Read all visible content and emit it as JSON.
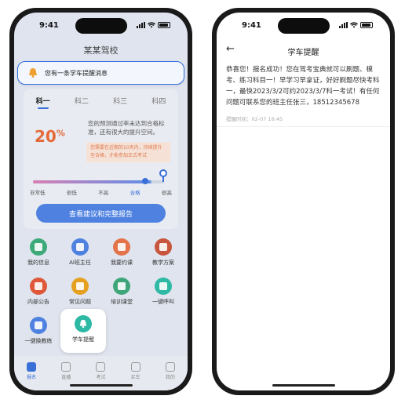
{
  "status": {
    "time": "9:41"
  },
  "left": {
    "title": "某某驾校",
    "toast": "您有一条学车提醒消息",
    "tabs": [
      "科一",
      "科二",
      "科三",
      "科四"
    ],
    "score": "20",
    "score_unit": "%",
    "score_desc": "您的预测通过率未达到合格标准，还有很大的提升空间。",
    "warn": "您需要在近期的10天内，持续提升至合格，才能参加正式考试",
    "progress": 0.82,
    "levels": [
      "非常低",
      "很低",
      "不高",
      "合格",
      "很高"
    ],
    "report_button": "查看建议和完整报告",
    "grid": [
      {
        "label": "我的信息",
        "color": "#3eaa7a",
        "icon": "id-card-icon"
      },
      {
        "label": "AI班主任",
        "color": "#4f82e0",
        "icon": "ai-person-icon"
      },
      {
        "label": "我要约课",
        "color": "#e4734a",
        "icon": "calendar-icon"
      },
      {
        "label": "教学方案",
        "color": "#c8563f",
        "icon": "book-icon"
      },
      {
        "label": "内部公告",
        "color": "#e0583a",
        "icon": "announcement-icon"
      },
      {
        "label": "常见问题",
        "color": "#e5a020",
        "icon": "question-icon"
      },
      {
        "label": "培训课堂",
        "color": "#3fa67a",
        "icon": "classroom-icon"
      },
      {
        "label": "一键呼叫",
        "color": "#2eb9a5",
        "icon": "phone-icon"
      },
      {
        "label": "一键换教练",
        "color": "#4f82e0",
        "icon": "coach-icon"
      }
    ],
    "highlight_label": "学车提醒",
    "tabbar": [
      "报名",
      "直播",
      "考试",
      "买车",
      "我的"
    ]
  },
  "right": {
    "title": "学车提醒",
    "message": "恭喜您！报名成功！您在驾考宝典就可以刷题、模考、练习科目一！早学习早拿证，好好刷题尽快考科一，最快2023/3/2可约2023/3/7科一考试！有任何问题可联系您的班主任张三，18512345678",
    "time_label": "提醒时间：02-07 16:45"
  }
}
